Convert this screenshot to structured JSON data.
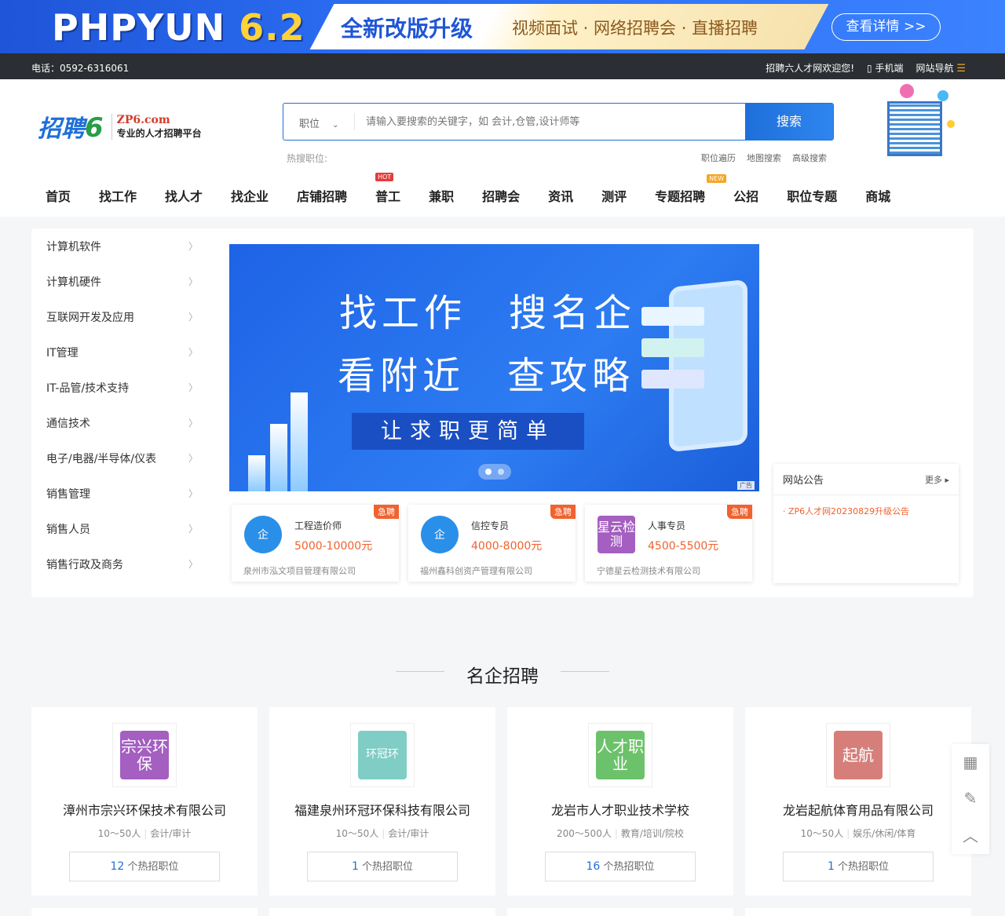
{
  "promo": {
    "brand": "PHPYUN",
    "version": "6.2",
    "slogan": "全新改版升级",
    "subtitle": "视频面试 · 网络招聘会 · 直播招聘",
    "button": "查看详情 >>"
  },
  "topbar": {
    "phone": "电话：0592-6316061",
    "welcome": "招聘六人才网欢迎您!",
    "mobile": "手机端",
    "site_nav": "网站导航"
  },
  "logo": {
    "mark": "招聘",
    "six": "6",
    "domain": "ZP6.com",
    "tagline": "专业的人才招聘平台"
  },
  "search": {
    "category": "职位",
    "placeholder": "请输入要搜索的关键字，如 会计,仓管,设计师等",
    "button": "搜索",
    "hot_label": "热搜职位:",
    "links": [
      "职位遍历",
      "地图搜索",
      "高级搜索"
    ]
  },
  "nav": [
    {
      "label": "首页"
    },
    {
      "label": "找工作"
    },
    {
      "label": "找人才"
    },
    {
      "label": "找企业"
    },
    {
      "label": "店铺招聘"
    },
    {
      "label": "普工",
      "badge": "HOT"
    },
    {
      "label": "兼职"
    },
    {
      "label": "招聘会"
    },
    {
      "label": "资讯"
    },
    {
      "label": "测评"
    },
    {
      "label": "专题招聘",
      "badge": "NEW"
    },
    {
      "label": "公招"
    },
    {
      "label": "职位专题"
    },
    {
      "label": "商城"
    }
  ],
  "categories": [
    "计算机软件",
    "计算机硬件",
    "互联网开发及应用",
    "IT管理",
    "IT-品管/技术支持",
    "通信技术",
    "电子/电器/半导体/仪表",
    "销售管理",
    "销售人员",
    "销售行政及商务"
  ],
  "banner": {
    "line1": "找工作　搜名企",
    "line2": "看附近　查攻略",
    "strip": "让求职更简单",
    "ad": "广告"
  },
  "urgent_jobs": [
    {
      "tag": "急聘",
      "logo": "企",
      "title": "工程造价师",
      "salary": "5000-10000元",
      "company": "泉州市泓文项目管理有限公司"
    },
    {
      "tag": "急聘",
      "logo": "企",
      "title": "信控专员",
      "salary": "4000-8000元",
      "company": "福州鑫科创资产管理有限公司"
    },
    {
      "tag": "急聘",
      "logo": "星云检测",
      "title": "人事专员",
      "salary": "4500-5500元",
      "company": "宁德星云检测技术有限公司"
    }
  ],
  "notice": {
    "title": "网站公告",
    "more": "更多",
    "items": [
      "ZP6人才网20230829升级公告"
    ]
  },
  "section_title": "名企招聘",
  "companies": [
    {
      "logo": "宗兴环保",
      "logo_color": "#a45fc0",
      "name": "漳州市宗兴环保技术有限公司",
      "size": "10～50人",
      "industry": "会计/审计",
      "count": "12",
      "count_suffix": " 个热招职位"
    },
    {
      "logo": "环冠环",
      "logo_color": "#7fcdc4",
      "name": "福建泉州环冠环保科技有限公司",
      "size": "10～50人",
      "industry": "会计/审计",
      "count": "1",
      "count_suffix": " 个热招职位"
    },
    {
      "logo": "人才职业",
      "logo_color": "#6cc26a",
      "name": "龙岩市人才职业技术学校",
      "size": "200～500人",
      "industry": "教育/培训/院校",
      "count": "16",
      "count_suffix": " 个热招职位"
    },
    {
      "logo": "起航",
      "logo_color": "#d67f7a",
      "name": "龙岩起航体育用品有限公司",
      "size": "10～50人",
      "industry": "娱乐/休闲/体育",
      "count": "1",
      "count_suffix": " 个热招职位"
    }
  ],
  "colors": {
    "primary": "#1e6fd9",
    "accent": "#f0622f",
    "topbar": "#2b2e33"
  },
  "float_tools": [
    "qrcode-icon",
    "edit-icon",
    "back-to-top-icon"
  ]
}
